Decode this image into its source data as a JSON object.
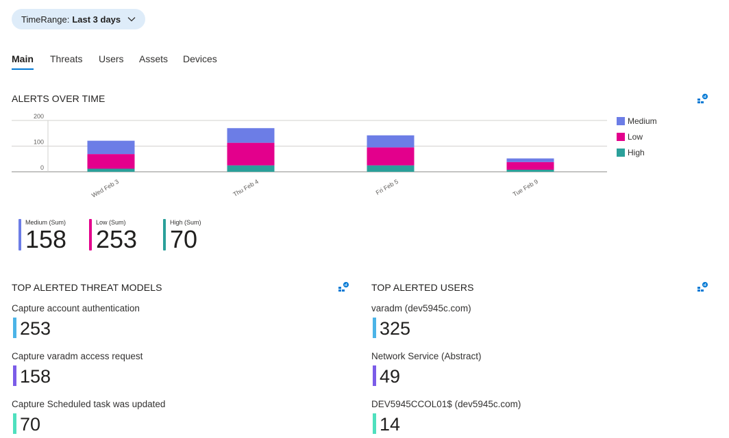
{
  "time_range": {
    "label": "TimeRange:",
    "value": "Last 3 days"
  },
  "tabs": [
    {
      "label": "Main",
      "active": true
    },
    {
      "label": "Threats"
    },
    {
      "label": "Users"
    },
    {
      "label": "Assets"
    },
    {
      "label": "Devices"
    }
  ],
  "alerts_over_time": {
    "title": "ALERTS OVER TIME",
    "chart_data": {
      "type": "bar",
      "stacked": true,
      "categories": [
        "Wed Feb 3",
        "Thu Feb 4",
        "Fri Feb 5",
        "Tue Feb 9"
      ],
      "series": [
        {
          "name": "High",
          "color": "#2ba09a",
          "values": [
            12,
            25,
            25,
            8
          ]
        },
        {
          "name": "Low",
          "color": "#e3008c",
          "values": [
            57,
            88,
            70,
            30
          ]
        },
        {
          "name": "Medium",
          "color": "#6c7de6",
          "values": [
            52,
            57,
            47,
            14
          ]
        }
      ],
      "ylim": [
        0,
        200
      ],
      "yticks": [
        0,
        100,
        200
      ],
      "grid": true,
      "legend": {
        "placement": "right",
        "order": [
          "Medium",
          "Low",
          "High"
        ]
      }
    }
  },
  "summary_tiles": [
    {
      "label": "Medium (Sum)",
      "value": "158",
      "color": "#6c7de6"
    },
    {
      "label": "Low (Sum)",
      "value": "253",
      "color": "#e3008c"
    },
    {
      "label": "High (Sum)",
      "value": "70",
      "color": "#2ba09a"
    }
  ],
  "top_threat_models": {
    "title": "TOP ALERTED THREAT MODELS",
    "items": [
      {
        "label": "Capture account authentication",
        "value": "253",
        "color": "#4cb4e7"
      },
      {
        "label": "Capture varadm access request",
        "value": "158",
        "color": "#7b5ce8"
      },
      {
        "label": "Capture Scheduled task was updated",
        "value": "70",
        "color": "#4fe0be"
      }
    ]
  },
  "top_users": {
    "title": "TOP ALERTED USERS",
    "items": [
      {
        "label": "varadm (dev5945c.com)",
        "value": "325",
        "color": "#4cb4e7"
      },
      {
        "label": "Network Service (Abstract)",
        "value": "49",
        "color": "#7b5ce8"
      },
      {
        "label": "DEV5945CCOL01$ (dev5945c.com)",
        "value": "14",
        "color": "#4fe0be"
      }
    ]
  },
  "icons": {
    "chart_visualize": "chart-visualize-icon",
    "chevron": "chevron-down-icon"
  }
}
